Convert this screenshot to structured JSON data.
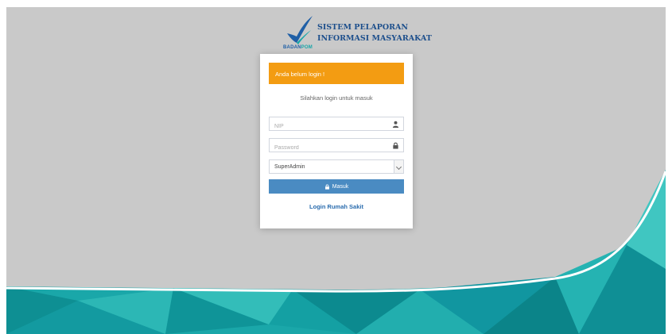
{
  "brand": {
    "logo_word_1": "BADAN",
    "logo_word_2": "POM",
    "title_line_1": "SISTEM PELAPORAN",
    "title_line_2": "INFORMASI MASYARAKAT"
  },
  "alert": {
    "text": "Anda belum login !"
  },
  "form": {
    "subtitle": "Silahkan login untuk masuk",
    "nip_placeholder": "NIP",
    "nip_value": "",
    "password_placeholder": "Password",
    "password_value": "",
    "role_selected": "SuperAdmin",
    "submit_label": "Masuk"
  },
  "links": {
    "rumah_sakit": "Login Rumah Sakit"
  },
  "icons": {
    "nip": "user-icon",
    "password": "lock-icon",
    "role": "chevron-down-icon",
    "submit": "lock-icon"
  },
  "colors": {
    "alert": "#f39c12",
    "button": "#4a8bc2",
    "link": "#2a6cae",
    "teal": "#17a5a8",
    "background": "#c9c9c9"
  }
}
